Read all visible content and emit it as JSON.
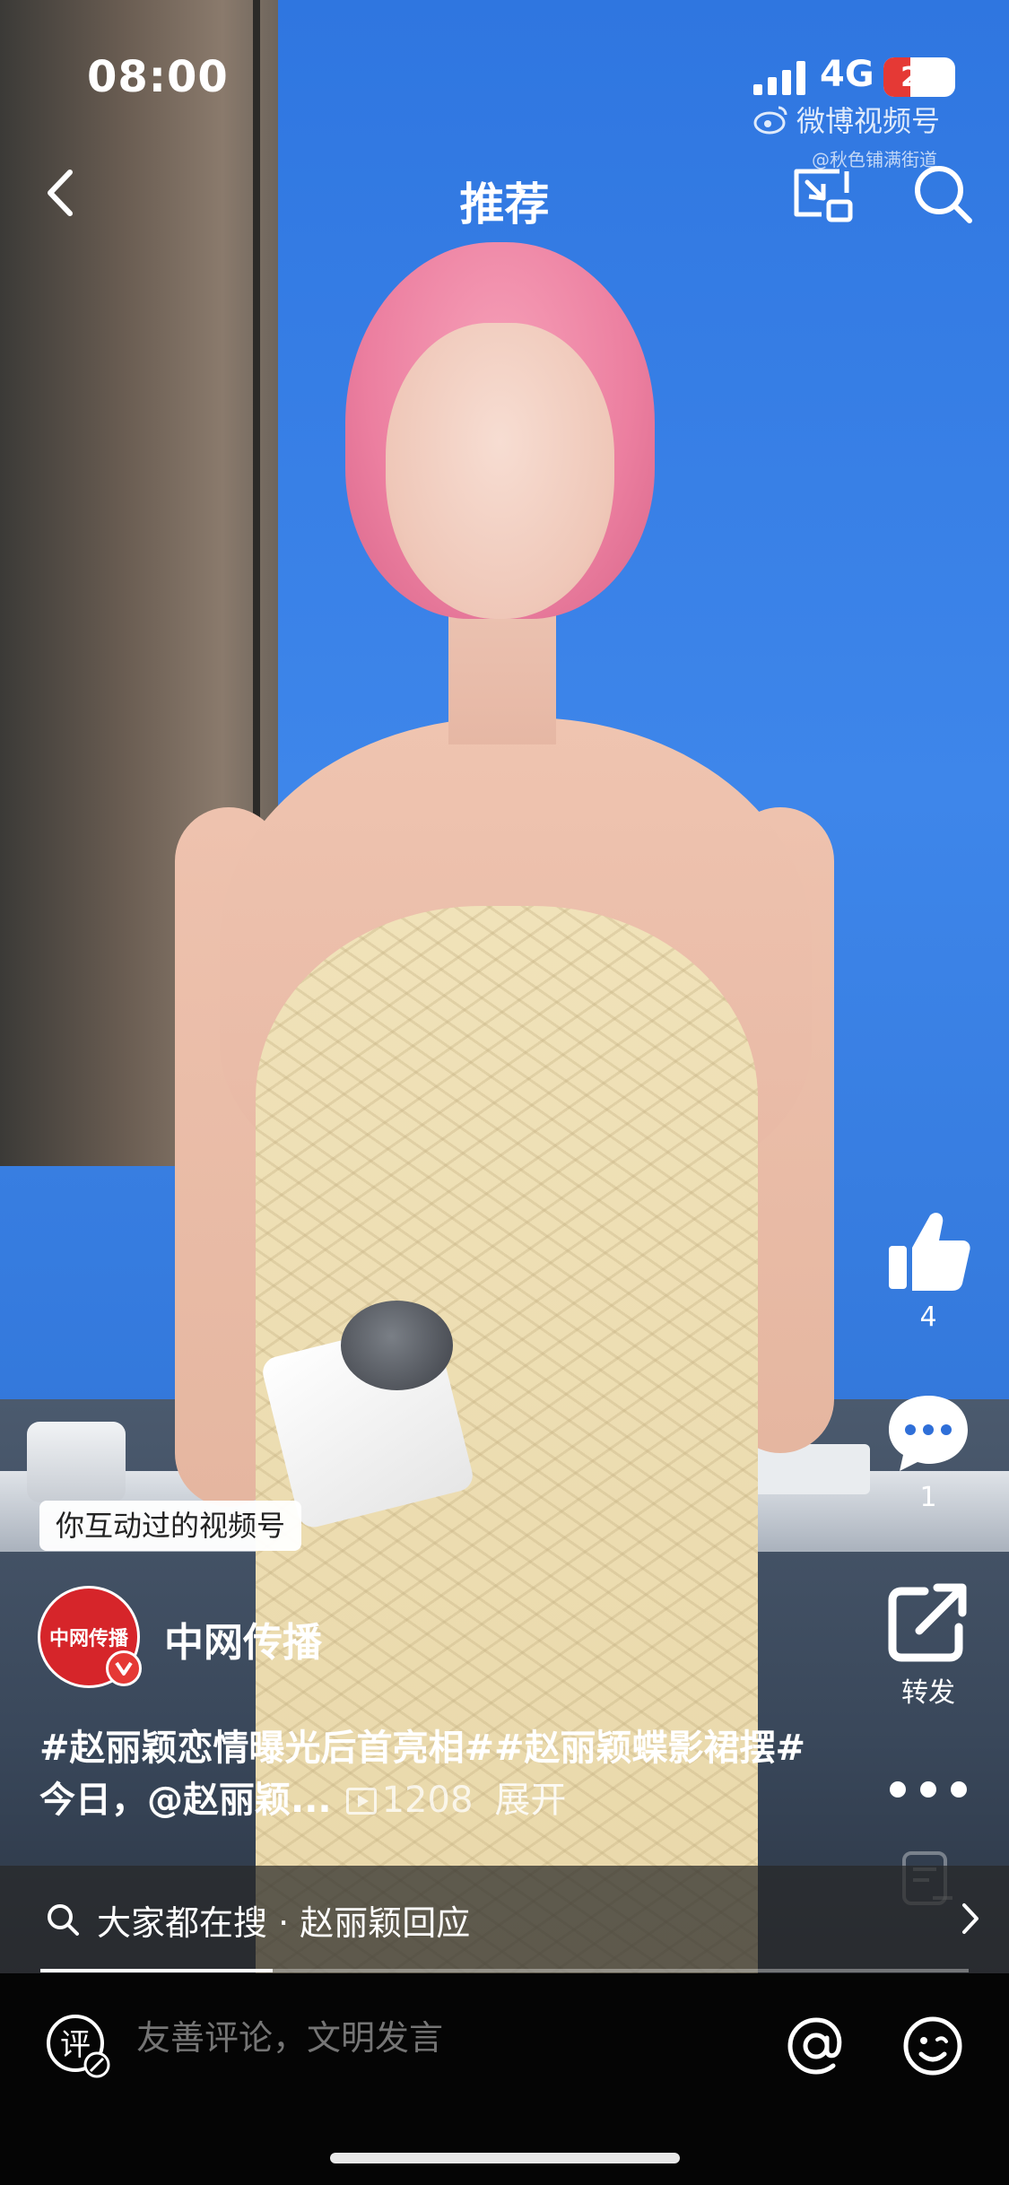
{
  "status_bar": {
    "time": "08:00",
    "network": "4G",
    "battery": "20"
  },
  "watermark": {
    "brand": "微博视频号",
    "handle": "@秋色铺满街道"
  },
  "nav": {
    "title": "推荐"
  },
  "actions": {
    "like_count": "4",
    "comment_count": "1",
    "share_label": "转发"
  },
  "tag_chip": "你互动过的视频号",
  "author": {
    "avatar_text": "中网传播",
    "name": "中网传播"
  },
  "caption": {
    "text": "#赵丽颖恋情曝光后首亮相##赵丽颖蝶影裙摆#今日，@赵丽颖...",
    "plays": "1208",
    "expand": "展开"
  },
  "hot_search": {
    "text": "大家都在搜 · 赵丽颖回应"
  },
  "playback": {
    "progress_fraction": 0.25
  },
  "comment_bar": {
    "placeholder": "友善评论，文明发言",
    "badge_char": "评"
  },
  "colors": {
    "accent_red": "#e53935",
    "background": "#000000"
  }
}
